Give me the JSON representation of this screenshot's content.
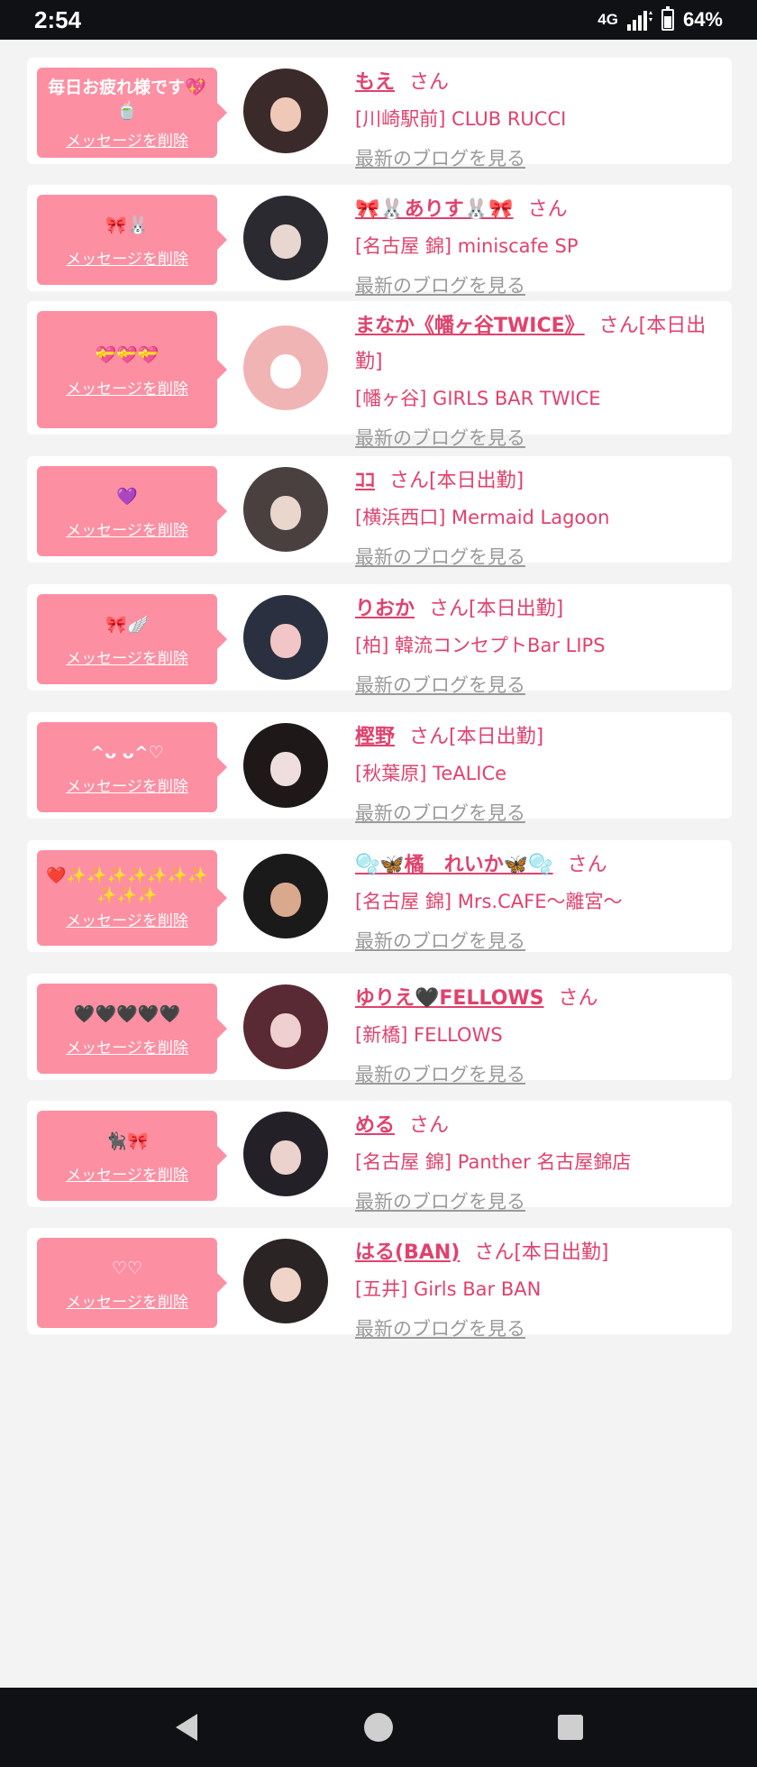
{
  "status_bar": {
    "time": "2:54",
    "network": "4G",
    "battery": "64%",
    "battery_level": 0.64
  },
  "cards": [
    {
      "message": "毎日お疲れ様です💖🍵",
      "delete_label": "メッセージを削除",
      "name": "もえ",
      "suffix": "さん",
      "shop": "[川崎駅前] CLUB RUCCI",
      "blog_label": "最新のブログを見る",
      "avatar_color": "#3a2a2a",
      "avatar_accent": "#f0c8b8"
    },
    {
      "message": "🎀🐰",
      "delete_label": "メッセージを削除",
      "name": "🎀🐰ありす🐰🎀",
      "suffix": "さん",
      "shop": "[名古屋 錦] miniscafe SP",
      "blog_label": "最新のブログを見る",
      "avatar_color": "#2b2a30",
      "avatar_accent": "#e8d7d0"
    },
    {
      "message": "💝💝💝",
      "delete_label": "メッセージを削除",
      "name": "まなか《幡ヶ谷TWICE》",
      "suffix": "さん[本日出勤]",
      "shop": "[幡ヶ谷] GIRLS BAR TWICE",
      "blog_label": "最新のブログを見る",
      "avatar_color": "#f1b4b4",
      "avatar_accent": "#ffffff"
    },
    {
      "message": "💜",
      "delete_label": "メッセージを削除",
      "name": "ｺｺ",
      "suffix": "さん[本日出勤]",
      "shop": "[横浜西口] Mermaid Lagoon",
      "blog_label": "最新のブログを見る",
      "avatar_color": "#4a4040",
      "avatar_accent": "#e9d6cc"
    },
    {
      "message": "🎀🪽",
      "delete_label": "メッセージを削除",
      "name": "りおか",
      "suffix": "さん[本日出勤]",
      "shop": "[柏] 韓流コンセプトBar LIPS",
      "blog_label": "最新のブログを見る",
      "avatar_color": "#2a3040",
      "avatar_accent": "#f2c6c6"
    },
    {
      "message": "^ᴗ ᴗ^♡",
      "delete_label": "メッセージを削除",
      "name": "樫野",
      "suffix": "さん[本日出勤]",
      "shop": "[秋葉原] TeALICe",
      "blog_label": "最新のブログを見る",
      "avatar_color": "#1e1818",
      "avatar_accent": "#eedede"
    },
    {
      "message": "❤️✨✨✨✨✨✨✨✨✨✨",
      "delete_label": "メッセージを削除",
      "name": "🫧🦋橘　れいか🦋🫧",
      "suffix": "さん",
      "shop": "[名古屋 錦] Mrs.CAFE〜離宮〜",
      "blog_label": "最新のブログを見る",
      "avatar_color": "#1a1a1a",
      "avatar_accent": "#d9a98e"
    },
    {
      "message": "🖤🖤🖤🖤🖤",
      "delete_label": "メッセージを削除",
      "name": "ゆりえ🖤FELLOWS",
      "suffix": "さん",
      "shop": "[新橋] FELLOWS",
      "blog_label": "最新のブログを見る",
      "avatar_color": "#5a2a34",
      "avatar_accent": "#efcfcf"
    },
    {
      "message": "🐈‍⬛🎀",
      "delete_label": "メッセージを削除",
      "name": "める",
      "suffix": "さん",
      "shop": "[名古屋 錦] Panther 名古屋錦店",
      "blog_label": "最新のブログを見る",
      "avatar_color": "#242028",
      "avatar_accent": "#ecd2cc"
    },
    {
      "message": "♡♡",
      "delete_label": "メッセージを削除",
      "name": "はる(BAN)",
      "suffix": "さん[本日出勤]",
      "shop": "[五井] Girls Bar BAN",
      "blog_label": "最新のブログを見る",
      "avatar_color": "#2a2424",
      "avatar_accent": "#f0d4c8"
    }
  ],
  "nav": {
    "back": "back-icon",
    "home": "home-icon",
    "recents": "recents-icon"
  },
  "colors": {
    "accent": "#e0426d",
    "bubble": "#fd8fa2",
    "background": "#f3f3f3",
    "blog_link": "#9a9a9a"
  }
}
